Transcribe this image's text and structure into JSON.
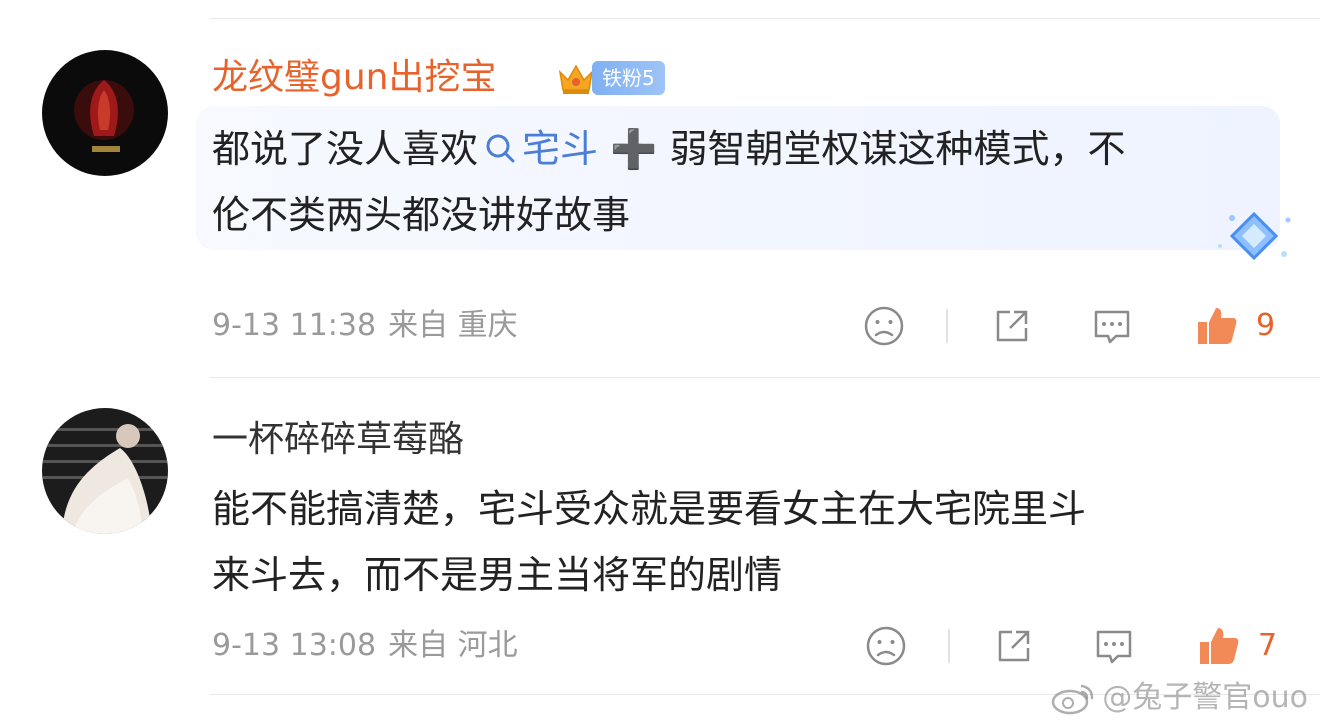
{
  "comments": [
    {
      "username": "龙纹璧gun出挖宝",
      "username_color": "#e8632c",
      "fan_badge": "铁粉5",
      "text_line1_before": "都说了没人喜欢",
      "tag_text": "宅斗",
      "plus_glyph": "➕",
      "text_line1_after": "弱智朝堂权谋这种模式，不",
      "text_line2": "伦不类两头都没讲好故事",
      "date": "9-13 11:38",
      "source": "来自 重庆",
      "likes": "9"
    },
    {
      "username": "一杯碎碎草莓酪",
      "username_color": "#333333",
      "text_line1": "能不能搞清楚，宅斗受众就是要看女主在大宅院里斗",
      "text_line2": "来斗去，而不是男主当将军的剧情",
      "date": "9-13 13:08",
      "source": "来自 河北",
      "likes": "7"
    }
  ],
  "watermark": "@兔子警官ouo",
  "colors": {
    "accent": "#e8632c",
    "link": "#4b7fd6",
    "meta": "#9a9a9a",
    "badge": "#8ab8f5"
  },
  "icons": [
    "search-icon",
    "crown-icon",
    "emoji-icon",
    "share-icon",
    "comment-icon",
    "like-icon",
    "weibo-logo-icon"
  ]
}
